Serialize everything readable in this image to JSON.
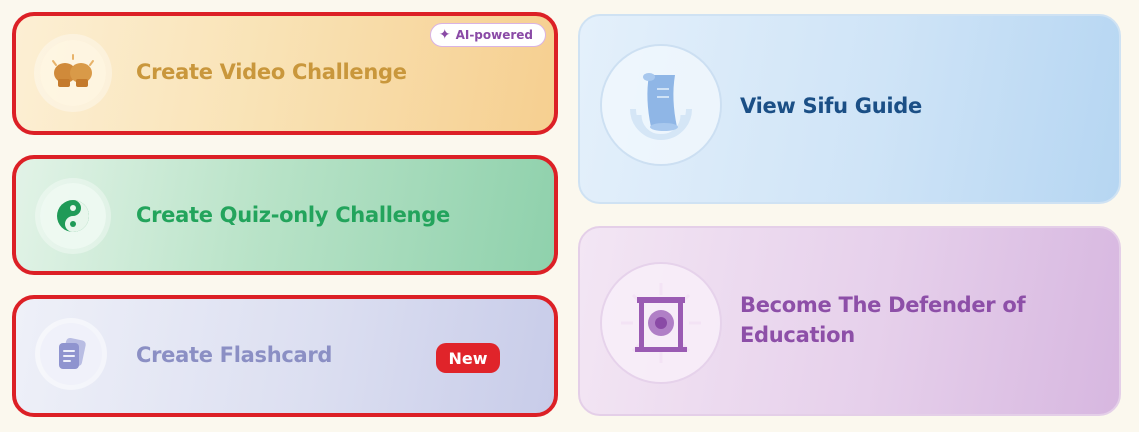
{
  "cards": {
    "video": {
      "label": "Create Video Challenge",
      "badge": "AI-powered",
      "icon": "boxing-gloves-icon"
    },
    "quiz": {
      "label": "Create Quiz-only Challenge",
      "icon": "yin-yang-icon"
    },
    "flashcard": {
      "label": "Create Flashcard",
      "badge": "New",
      "icon": "document-stack-icon"
    },
    "sifu": {
      "label": "View Sifu Guide",
      "icon": "scroll-icon"
    },
    "defender": {
      "label": "Become The Defender of Education",
      "icon": "gong-icon"
    }
  },
  "colors": {
    "outline": "#dc2026",
    "video_text": "#c9973c",
    "quiz_text": "#23a45c",
    "flash_text": "#8b8fc4",
    "sifu_text": "#1b4f86",
    "defender_text": "#8d4fa8",
    "new_badge": "#e0242a",
    "ai_badge_text": "#8a4aa6"
  }
}
